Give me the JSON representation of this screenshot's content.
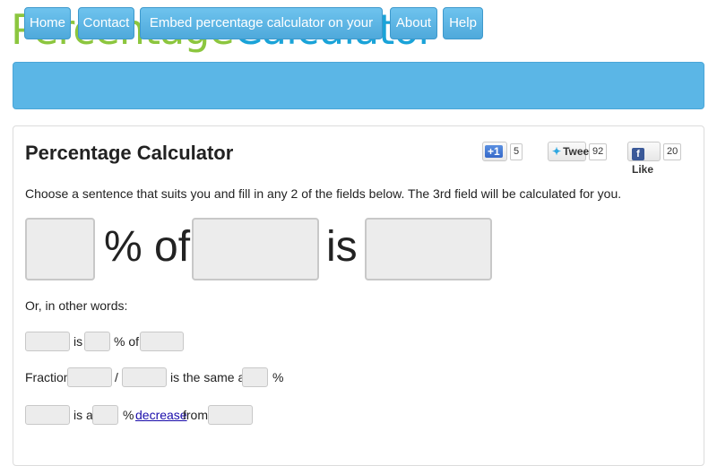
{
  "logo": {
    "part1": "Percentage",
    "part2": "Calculator"
  },
  "nav": {
    "items": [
      {
        "label": "Home"
      },
      {
        "label": "Contact"
      },
      {
        "label": "Embed percentage calculator on your website!"
      },
      {
        "label": "About"
      },
      {
        "label": "Help"
      }
    ]
  },
  "social": {
    "gplus_label": "+1",
    "gplus_count": "5",
    "tweet_label": "Tweet",
    "tweet_count": "92",
    "like_label": "Like",
    "like_count": "20"
  },
  "main": {
    "title": "Percentage Calculator",
    "intro": "Choose a sentence that suits you and fill in any 2 of the fields below. The 3rd field will be calculated for you.",
    "big": {
      "percent_of": "% of",
      "is": "is"
    },
    "other_words": "Or, in other words:",
    "row1": {
      "is": "is",
      "percent_of": "% of"
    },
    "row2": {
      "fraction": "Fraction",
      "slash": "/",
      "same_as": "is the same as",
      "percent": "%"
    },
    "row3": {
      "is_a": "is a",
      "percent": "%",
      "decrease": "decrease",
      "from": "from"
    }
  }
}
